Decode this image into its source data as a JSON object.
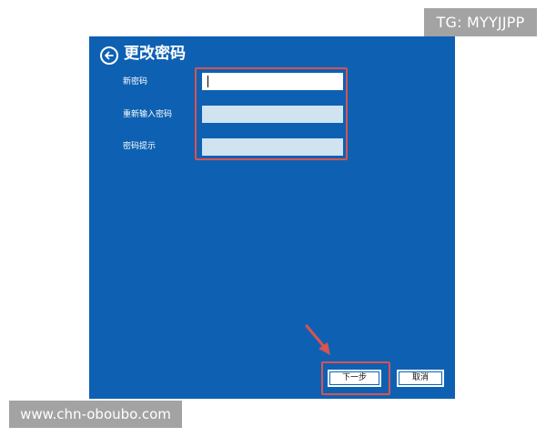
{
  "watermarks": {
    "top_right": "TG: MYYJJPP",
    "bottom_left": "www.chn-oboubo.com"
  },
  "dialog": {
    "title": "更改密码",
    "back_icon": "back-arrow-circle-icon",
    "fields": [
      {
        "label": "新密码",
        "value": "",
        "placeholder": ""
      },
      {
        "label": "重新输入密码",
        "value": "",
        "placeholder": ""
      },
      {
        "label": "密码提示",
        "value": "",
        "placeholder": ""
      }
    ],
    "buttons": {
      "next_label": "下一步",
      "cancel_label": "取消"
    }
  },
  "colors": {
    "panel_background": "#0e61b2",
    "highlight": "#d9534f",
    "inactive_input": "#cfe3f0",
    "watermark": "#a3a3a3"
  }
}
